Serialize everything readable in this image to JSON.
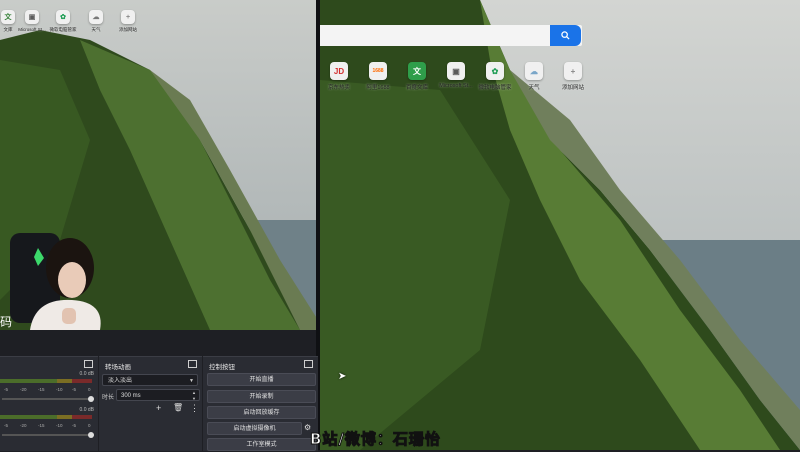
{
  "left_preview": {
    "tiles": [
      {
        "icon": "document-icon",
        "label": "文库",
        "color": "#2f7d32"
      },
      {
        "icon": "microsoft-store-icon",
        "label": "Microsoft St...",
        "color": "#5b5b5b"
      },
      {
        "icon": "pc-manager-icon",
        "label": "微软电脑管家",
        "color": "#1f9d55"
      },
      {
        "icon": "weather-icon",
        "label": "天气",
        "color": "#777777"
      },
      {
        "icon": "add-icon",
        "label": "添加网站",
        "color": "#888888"
      }
    ]
  },
  "right_preview": {
    "search_placeholder": "",
    "tiles": [
      {
        "icon": "jd-icon",
        "glyph": "JD",
        "label": "京东热卖",
        "color": "#d32f2f"
      },
      {
        "icon": "alibaba-icon",
        "glyph": "1688",
        "label": "阿里1688",
        "color": "#ff6a00"
      },
      {
        "icon": "document-icon",
        "glyph": "文",
        "label": "百度文库",
        "color": "#2f7d32"
      },
      {
        "icon": "microsoft-store-icon",
        "glyph": "▣",
        "label": "Microsoft St...",
        "color": "#5b5b5b"
      },
      {
        "icon": "pc-manager-icon",
        "glyph": "✿",
        "label": "微软电脑管家",
        "color": "#1f9d55"
      },
      {
        "icon": "weather-icon",
        "glyph": "☁",
        "label": "天气",
        "color": "#777777"
      },
      {
        "icon": "add-icon",
        "glyph": "+",
        "label": "添加网站",
        "color": "#888888"
      }
    ]
  },
  "mixer": {
    "db_top": "0.0 dB",
    "db_bottom": "0.0 dB",
    "scale": [
      "-5",
      "-20",
      "-15",
      "-10",
      "-5",
      "0"
    ]
  },
  "transition": {
    "title": "转场动画",
    "selected": "淡入淡出",
    "duration_label": "时长",
    "duration_value": "300 ms"
  },
  "controls": {
    "title": "控制按钮",
    "buttons": [
      "开始直播",
      "开始录制",
      "启动回放缓存",
      "启动虚拟摄像机",
      "工作室模式"
    ]
  },
  "overlay": {
    "text": "B站/微博：石珊怡"
  }
}
